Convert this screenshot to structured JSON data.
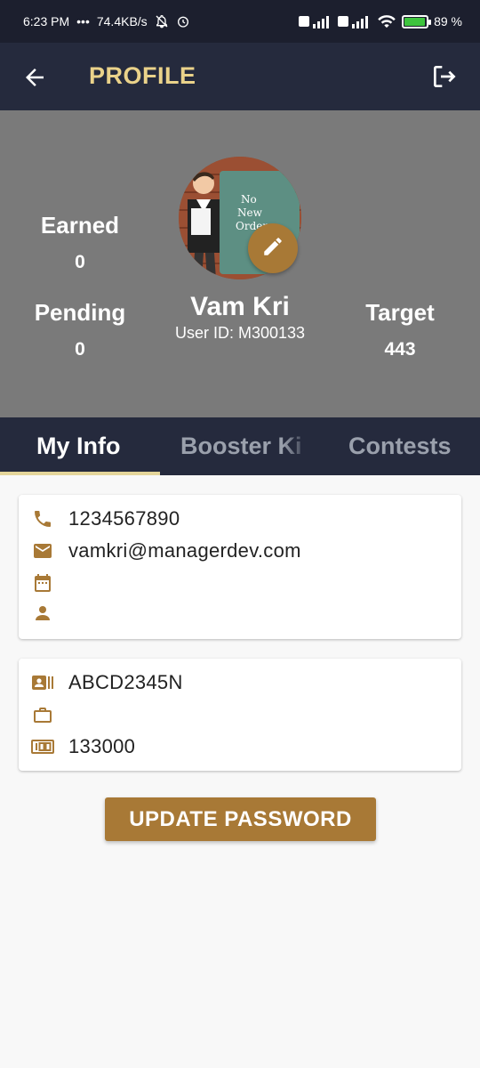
{
  "statusbar": {
    "time": "6:23 PM",
    "dots": "•••",
    "net_speed": "74.4KB/s",
    "battery": "89 %",
    "battery_level": 0.89
  },
  "appbar": {
    "title": "PROFILE",
    "back_icon": "arrow-left-icon",
    "logout_icon": "logout-icon"
  },
  "profile": {
    "earned_label": "Earned",
    "earned_value": "0",
    "pending_label": "Pending",
    "pending_value": "0",
    "target_label": "Target",
    "target_value": "443",
    "name": "Vam Kri",
    "user_id": "User ID: M300133",
    "avatar_board_text": [
      "No",
      "New",
      "Orders"
    ]
  },
  "tabs": [
    {
      "label": "My Info",
      "active": true
    },
    {
      "label": "Booster Kit",
      "active": false
    },
    {
      "label": "Contests",
      "active": false
    }
  ],
  "info_card": {
    "phone": "1234567890",
    "email": "vamkri@managerdev.com",
    "dob": "",
    "gender": ""
  },
  "work_card": {
    "id_number": "ABCD2345N",
    "occupation": "",
    "salary": "133000"
  },
  "update_password_label": "UPDATE PASSWORD",
  "colors": {
    "header": "#252a3d",
    "accent": "#a87936",
    "title": "#ead28a",
    "profile_bg": "#7a7a7a"
  }
}
